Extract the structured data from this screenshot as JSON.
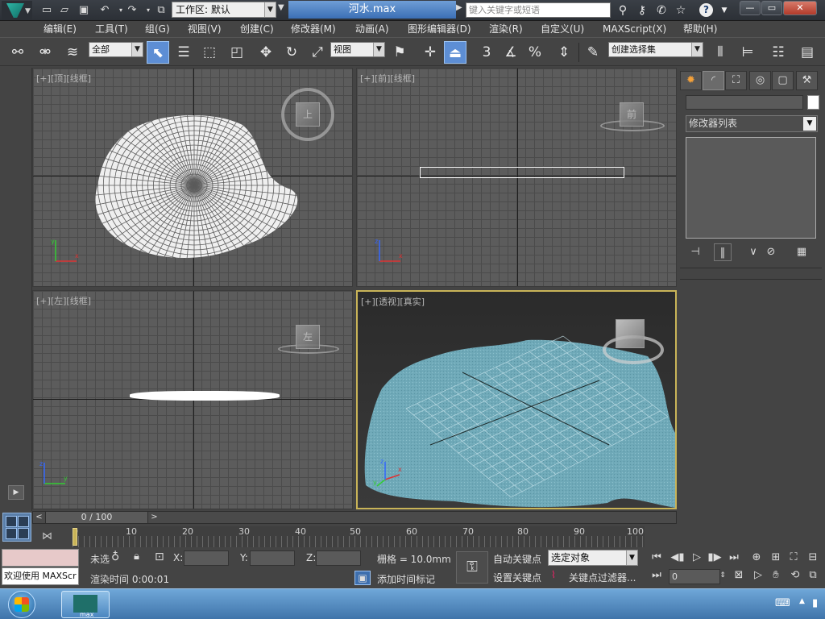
{
  "titlebar": {
    "workspace_label": "工作区: 默认",
    "document_title": "河水.max",
    "search_placeholder": "键入关键字或短语",
    "window_controls": [
      "—",
      "▭",
      "✕"
    ]
  },
  "menu": [
    "编辑(E)",
    "工具(T)",
    "组(G)",
    "视图(V)",
    "创建(C)",
    "修改器(M)",
    "动画(A)",
    "图形编辑器(D)",
    "渲染(R)",
    "自定义(U)",
    "MAXScript(X)",
    "帮助(H)"
  ],
  "toolbar": {
    "filter_select": "全部",
    "reference_coord": "视图",
    "named_selection": "创建选择集",
    "snap_labels": [
      "3",
      "%"
    ]
  },
  "viewports": {
    "top": {
      "label": "[+]",
      "view": "[顶]",
      "mode": "[线框]",
      "cube_label": "上"
    },
    "front": {
      "label": "[+]",
      "view": "[前]",
      "mode": "[线框]",
      "cube_label": "前"
    },
    "left": {
      "label": "[+]",
      "view": "[左]",
      "mode": "[线框]",
      "cube_label": "左"
    },
    "perspective": {
      "label": "[+]",
      "view": "[透视]",
      "mode": "[真实]"
    },
    "axis_labels": {
      "x": "x",
      "y": "y",
      "z": "z"
    }
  },
  "command_panel": {
    "modifier_list": "修改器列表"
  },
  "timeline": {
    "frame_display": "0 / 100",
    "ticks": [
      "0",
      "10",
      "20",
      "30",
      "40",
      "50",
      "60",
      "70",
      "80",
      "90",
      "100"
    ]
  },
  "status": {
    "welcome": "欢迎使用 MAXScr",
    "selection_status": "未选",
    "x_label": "X:",
    "y_label": "Y:",
    "z_label": "Z:",
    "grid": "栅格 = 10.0mm",
    "render_time": "渲染时间  0:00:01",
    "add_time_tag": "添加时间标记",
    "auto_key": "自动关键点",
    "set_key": "设置关键点",
    "key_mode": "选定对象",
    "key_filters": "关键点过滤器...",
    "current_frame": "0"
  },
  "colors": {
    "accent_blue": "#5d8ed4",
    "water": "#6fa9b8",
    "active_viewport_border": "#c9b458"
  }
}
